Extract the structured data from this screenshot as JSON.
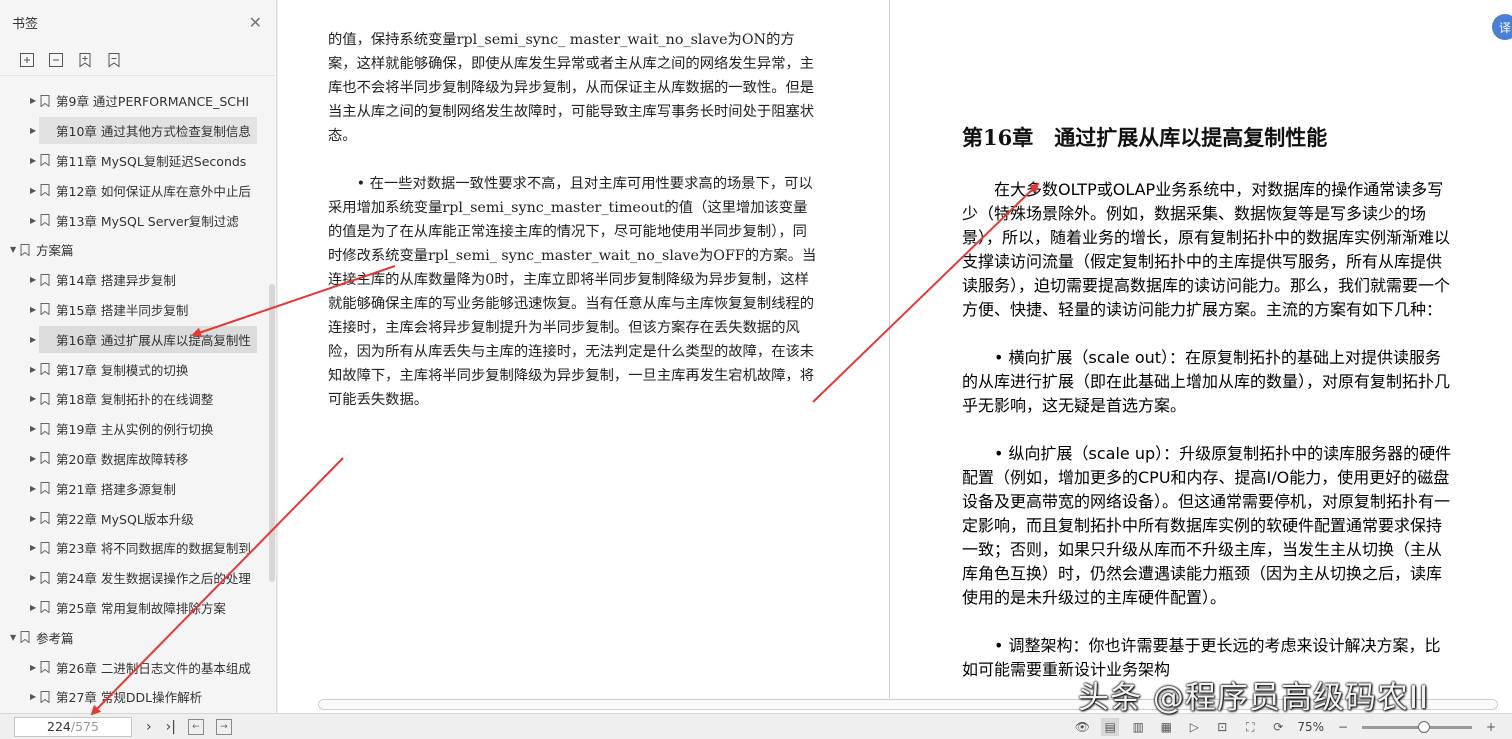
{
  "sidebar": {
    "title": "书签",
    "items": [
      {
        "label": "第9章 通过PERFORMANCE_SCHI",
        "level": 1,
        "state": ""
      },
      {
        "label": "第10章 通过其他方式检查复制信息",
        "level": 1,
        "state": "hl"
      },
      {
        "label": "第11章 MySQL复制延迟Seconds",
        "level": 1,
        "state": ""
      },
      {
        "label": "第12章 如何保证从库在意外中止后",
        "level": 1,
        "state": ""
      },
      {
        "label": "第13章 MySQL Server复制过滤",
        "level": 1,
        "state": ""
      },
      {
        "label": "方案篇",
        "level": 0,
        "state": ""
      },
      {
        "label": "第14章 搭建异步复制",
        "level": 1,
        "state": ""
      },
      {
        "label": "第15章 搭建半同步复制",
        "level": 1,
        "state": ""
      },
      {
        "label": "第16章 通过扩展从库以提高复制性",
        "level": 1,
        "state": "sel"
      },
      {
        "label": "第17章 复制模式的切换",
        "level": 1,
        "state": ""
      },
      {
        "label": "第18章 复制拓扑的在线调整",
        "level": 1,
        "state": ""
      },
      {
        "label": "第19章 主从实例的例行切换",
        "level": 1,
        "state": ""
      },
      {
        "label": "第20章 数据库故障转移",
        "level": 1,
        "state": ""
      },
      {
        "label": "第21章 搭建多源复制",
        "level": 1,
        "state": ""
      },
      {
        "label": "第22章 MySQL版本升级",
        "level": 1,
        "state": ""
      },
      {
        "label": "第23章 将不同数据库的数据复制到",
        "level": 1,
        "state": ""
      },
      {
        "label": "第24章 发生数据误操作之后的处理",
        "level": 1,
        "state": ""
      },
      {
        "label": "第25章 常用复制故障排除方案",
        "level": 1,
        "state": ""
      },
      {
        "label": "参考篇",
        "level": 0,
        "state": ""
      },
      {
        "label": "第26章 二进制日志文件的基本组成",
        "level": 1,
        "state": ""
      },
      {
        "label": "第27章 常规DDL操作解析",
        "level": 1,
        "state": ""
      }
    ]
  },
  "left_page": {
    "paragraphs": [
      "的值，保持系统变量rpl_semi_sync_ master_wait_no_slave为ON的方案，这样就能够确保，即使从库发生异常或者主从库之间的网络发生异常，主库也不会将半同步复制降级为异步复制，从而保证主从库数据的一致性。但是当主从库之间的复制网络发生故障时，可能导致主库写事务长时间处于阻塞状态。",
      "• 在一些对数据一致性要求不高，且对主库可用性要求高的场景下，可以采用增加系统变量rpl_semi_sync_master_timeout的值（这里增加该变量的值是为了在从库能正常连接主库的情况下，尽可能地使用半同步复制），同时修改系统变量rpl_semi_ sync_master_wait_no_slave为OFF的方案。当连接主库的从库数量降为0时，主库立即将半同步复制降级为异步复制，这样就能够确保主库的写业务能够迅速恢复。当有任意从库与主库恢复复制线程的连接时，主库会将异步复制提升为半同步复制。但该方案存在丢失数据的风险，因为所有从库丢失与主库的连接时，无法判定是什么类型的故障，在该未知故障下，主库将半同步复制降级为异步复制，一旦主库再发生宕机故障，将可能丢失数据。"
    ]
  },
  "right_page": {
    "chapter_title": "第16章　通过扩展从库以提高复制性能",
    "paragraphs": [
      "在大多数OLTP或OLAP业务系统中，对数据库的操作通常读多写少（特殊场景除外。例如，数据采集、数据恢复等是写多读少的场景），所以，随着业务的增长，原有复制拓扑中的数据库实例渐渐难以支撑读访问流量（假定复制拓扑中的主库提供写服务，所有从库提供读服务），迫切需要提高数据库的读访问能力。那么，我们就需要一个方便、快捷、轻量的读访问能力扩展方案。主流的方案有如下几种：",
      "• 横向扩展（scale out）：在原复制拓扑的基础上对提供读服务的从库进行扩展（即在此基础上增加从库的数量），对原有复制拓扑几乎无影响，这无疑是首选方案。",
      "• 纵向扩展（scale up）：升级原复制拓扑中的读库服务器的硬件配置（例如，增加更多的CPU和内存、提高I/O能力，使用更好的磁盘设备及更高带宽的网络设备）。但这通常需要停机，对原复制拓扑有一定影响，而且复制拓扑中所有数据库实例的软硬件配置通常要求保持一致；否则，如果只升级从库而不升级主库，当发生主从切换（主从库角色互换）时，仍然会遭遇读能力瓶颈（因为主从切换之后，读库使用的是未升级过的主库硬件配置）。",
      "• 调整架构：你也许需要基于更长远的考虑来设计解决方案，比如可能需要重新设计业务架构"
    ]
  },
  "status_bar": {
    "current_page": "224",
    "total_pages": "/575",
    "zoom": "75%",
    "zoom_fraction": 0.56
  },
  "watermark": "头条 @程序员高级码农II",
  "colors": {
    "arrow": "#e53935",
    "accent": "#4a7fd8"
  }
}
